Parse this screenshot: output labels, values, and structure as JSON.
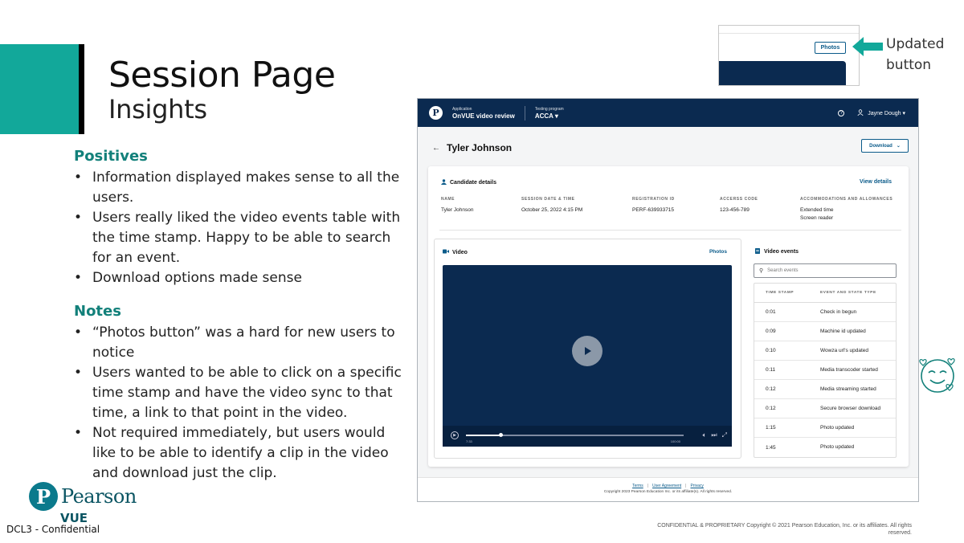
{
  "slide": {
    "title": "Session Page",
    "subtitle": "Insights",
    "positives_heading": "Positives",
    "positives": [
      "Information displayed makes sense to all the users.",
      "Users really liked the video events table with the time stamp. Happy to be able to search for an event.",
      "Download options made sense"
    ],
    "notes_heading": "Notes",
    "notes": [
      "“Photos button” was a hard for new users to notice",
      "Users wanted to be able to click on a specific time stamp and have the video sync to that time, a link to that point in the video.",
      "Not required immediately, but users would like to be able to identify a clip in the video and download just the clip."
    ],
    "logo_text": "Pearson",
    "logo_sub": "VUE",
    "confidential": "DCL3 - Confidential",
    "footer_copyright": "CONFIDENTIAL & PROPRIETARY   Copyright © 2021  Pearson Education, Inc. or its affiliates. All rights reserved.",
    "callout": {
      "button_label": "Photos",
      "label_line1": "Updated",
      "label_line2": "button"
    },
    "colors": {
      "accent": "#12a89a",
      "navy": "#0b2a50",
      "link": "#0b5b8a"
    }
  },
  "app": {
    "header": {
      "app_small": "Application",
      "app_name": "OnVUE video review",
      "program_small": "Testing program",
      "program_name": "ACCA",
      "user_name": "Jayne Dough"
    },
    "page_title": "Tyler Johnson",
    "download_label": "Download",
    "candidate": {
      "title": "Candidate details",
      "view_details": "View details",
      "fields": [
        {
          "label": "NAME",
          "value": "Tyler Johnson",
          "value2": ""
        },
        {
          "label": "SESSION DATE & TIME",
          "value": "October 25, 2022 4:15 PM",
          "value2": ""
        },
        {
          "label": "REGISTRATION ID",
          "value": "PERF-639933715",
          "value2": ""
        },
        {
          "label": "ACCERSS CODE",
          "value": "123-456-789",
          "value2": ""
        },
        {
          "label": "ACCOMMODATIONS AND ALLOWANCES",
          "value": "Extended time",
          "value2": "Screen reader"
        }
      ]
    },
    "video": {
      "title": "Video",
      "photos_link": "Photos",
      "current_time": "7:33",
      "total_time": "100:00",
      "progress": 0.16
    },
    "events": {
      "title": "Video events",
      "search_placeholder": "Search events",
      "col_time": "TIME STAMP",
      "col_event": "EVENT AND STATE TYPE",
      "rows": [
        {
          "time": "0:01",
          "event": "Check in begun"
        },
        {
          "time": "0:09",
          "event": "Machine id updated"
        },
        {
          "time": "0:10",
          "event": "Wowza url's updated"
        },
        {
          "time": "0:11",
          "event": "Media transcoder started"
        },
        {
          "time": "0:12",
          "event": "Media streaming started"
        },
        {
          "time": "0:12",
          "event": "Secure browser download"
        },
        {
          "time": "1:15",
          "event": "Photo updated"
        },
        {
          "time": "1:45",
          "event": "Photo updated"
        }
      ]
    },
    "footer": {
      "terms": "Terms",
      "user_agreement": "User Agreement",
      "privacy": "Privacy",
      "copyright": "Copyright 2023 Pearson Education Inc. or its affiliate(s). All rights reserved."
    }
  }
}
